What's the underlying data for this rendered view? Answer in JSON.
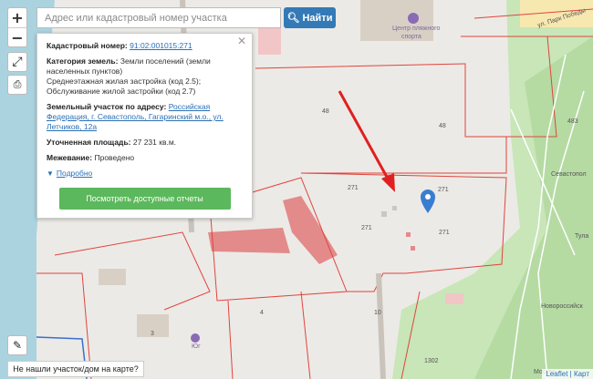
{
  "search": {
    "placeholder": "Адрес или кадастровый номер участка",
    "button_label": "Найти"
  },
  "controls": {
    "zoom_in": "+",
    "zoom_out": "−"
  },
  "panel": {
    "cadastral_label": "Кадастровый номер:",
    "cadastral_value": "91:02:001015:271",
    "category_label": "Категория земель:",
    "category_value": "Земли поселений (земли населенных пунктов)",
    "use_1": "Среднеэтажная жилая застройка (код 2.5);",
    "use_2": "Обслуживание жилой застройки (код 2.7)",
    "address_label": "Земельный участок по адресу:",
    "address_value": "Российская Федерация, г. Севастополь, Гагаринский м.о., ул. Летчиков, 12а",
    "area_label": "Уточненная площадь:",
    "area_value": "27 231 кв.м.",
    "survey_label": "Межевание:",
    "survey_value": "Проведено",
    "more_label": "Подробно",
    "reports_button": "Посмотреть доступные отчеты"
  },
  "map_labels": {
    "sport_center": "Центр пляжного\nспорта",
    "park_street": "ул. Парк Победы",
    "sevastopol": "Севастопол",
    "tula": "Тула",
    "novorossiysk": "Новороссийск",
    "moskva": "Москва",
    "yug": "Юг",
    "parcels": [
      "48",
      "48",
      "271",
      "271",
      "271",
      "271",
      "483",
      "4",
      "10",
      "1302",
      "3"
    ]
  },
  "bottom": {
    "not_found": "Не нашли участок/дом на карте?",
    "leaflet": "Leaflet | Карт"
  },
  "colors": {
    "accent": "#337ab7",
    "green_button": "#5cb85c",
    "parcel_border": "#e0443e",
    "arrow": "#e02020",
    "marker": "#3a7dd0"
  }
}
